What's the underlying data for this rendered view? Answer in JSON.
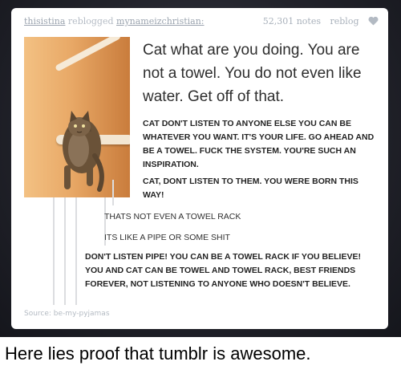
{
  "post": {
    "reblogger": "thisistina",
    "verb": "reblogged",
    "source_user": "mynameizchristian:",
    "notes": "52,301 notes",
    "reblog": "reblog",
    "like_icon": "heart-icon"
  },
  "photo": {
    "subject": "cat-icon"
  },
  "quote": "Cat what are you doing. You are not a towel. You do not even like water. Get off of that.",
  "replies": [
    "CAT DON'T LISTEN TO ANYONE ELSE YOU CAN BE WHATEVER YOU WANT. IT'S YOUR LIFE. GO AHEAD AND BE A TOWEL. FUCK THE SYSTEM. YOU'RE SUCH AN INSPIRATION.",
    "CAT, DONT LISTEN TO THEM. YOU WERE BORN THIS WAY!",
    "THATS NOT EVEN A TOWEL RACK",
    "ITS LIKE A PIPE OR SOME SHIT",
    "DON'T LISTEN PIPE! YOU CAN BE A TOWEL RACK IF YOU BELIEVE! YOU AND CAT CAN BE TOWEL AND TOWEL RACK, BEST FRIENDS FOREVER, NOT LISTENING TO ANYONE WHO DOESN'T BELIEVE."
  ],
  "source": "Source: be-my-pyjamas",
  "caption": "Here lies proof that tumblr is awesome.",
  "colors": {
    "background": "#22232b",
    "post": "#ffffff",
    "meta_text": "#a9b1bb"
  }
}
